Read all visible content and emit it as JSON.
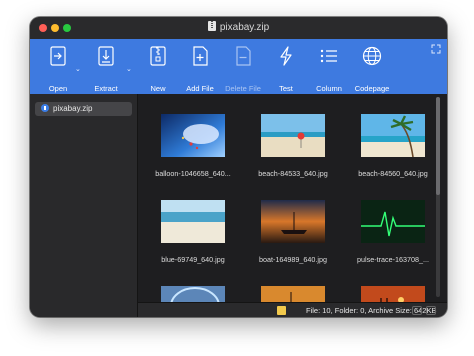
{
  "window": {
    "title": "pixabay.zip"
  },
  "toolbar": {
    "items": [
      {
        "label": "Open",
        "icon": "open-icon"
      },
      {
        "label": "Extract",
        "icon": "extract-icon"
      },
      {
        "label": "New",
        "icon": "new-archive-icon"
      },
      {
        "label": "Add File",
        "icon": "add-file-icon"
      },
      {
        "label": "Delete File",
        "icon": "delete-file-icon",
        "disabled": true
      },
      {
        "label": "Test",
        "icon": "test-icon"
      },
      {
        "label": "Column",
        "icon": "column-icon"
      },
      {
        "label": "Codepage",
        "icon": "codepage-icon"
      }
    ],
    "accent": "#3e7ae0"
  },
  "sidebar": {
    "items": [
      {
        "label": "pixabay.zip",
        "icon": "archive-icon"
      }
    ]
  },
  "files": [
    {
      "name": "balloon-1046658_640...",
      "scene": "balloon"
    },
    {
      "name": "beach-84533_640.jpg",
      "scene": "beach"
    },
    {
      "name": "beach-84560_640.jpg",
      "scene": "palm"
    },
    {
      "name": "blue-69749_640.jpg",
      "scene": "blue"
    },
    {
      "name": "boat-164989_640.jpg",
      "scene": "boat"
    },
    {
      "name": "pulse-trace-163708_...",
      "scene": "pulse"
    },
    {
      "name": "",
      "scene": "rainbow"
    },
    {
      "name": "",
      "scene": "sunset-ship"
    },
    {
      "name": "",
      "scene": "people-sunset"
    }
  ],
  "status": {
    "text": "File: 10, Folder: 0, Archive Size: 642KB"
  }
}
